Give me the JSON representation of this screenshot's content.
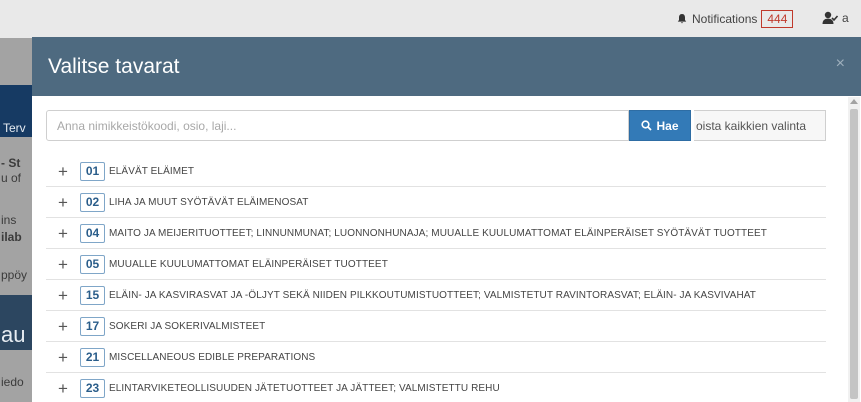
{
  "background": {
    "notifications_label": "Notifications",
    "notifications_count": "444",
    "user_fragment": "a",
    "fragments": [
      "Terv",
      "- St",
      "u of",
      "ins",
      "ilab",
      "ppöy",
      "au",
      "iedo"
    ]
  },
  "modal": {
    "title": "Valitse tavarat",
    "close": "×",
    "search": {
      "placeholder": "Anna nimikkeistökoodi, osio, laji...",
      "value": "",
      "button_label": "Hae",
      "clear_label": "oista kaikkien valinta"
    },
    "items": [
      {
        "code": "01",
        "name": "ELÄVÄT ELÄIMET"
      },
      {
        "code": "02",
        "name": "LIHA JA MUUT SYÖTÄVÄT ELÄIMENOSAT"
      },
      {
        "code": "04",
        "name": "MAITO JA MEIJERITUOTTEET; LINNUNMUNAT; LUONNONHUNAJA; MUUALLE KUULUMATTOMAT ELÄINPERÄISET SYÖTÄVÄT TUOTTEET"
      },
      {
        "code": "05",
        "name": "MUUALLE KUULUMATTOMAT ELÄINPERÄISET TUOTTEET"
      },
      {
        "code": "15",
        "name": "ELÄIN- JA KASVIRASVAT JA -ÖLJYT SEKÄ NIIDEN PILKKOUTUMISTUOTTEET; VALMISTETUT RAVINTORASVAT; ELÄIN- JA KASVIVAHAT"
      },
      {
        "code": "17",
        "name": "SOKERI JA SOKERIVALMISTEET"
      },
      {
        "code": "21",
        "name": "MISCELLANEOUS EDIBLE PREPARATIONS"
      },
      {
        "code": "23",
        "name": "ELINTARVIKETEOLLISUUDEN JÄTETUOTTEET JA JÄTTEET; VALMISTETTU REHU"
      }
    ]
  }
}
